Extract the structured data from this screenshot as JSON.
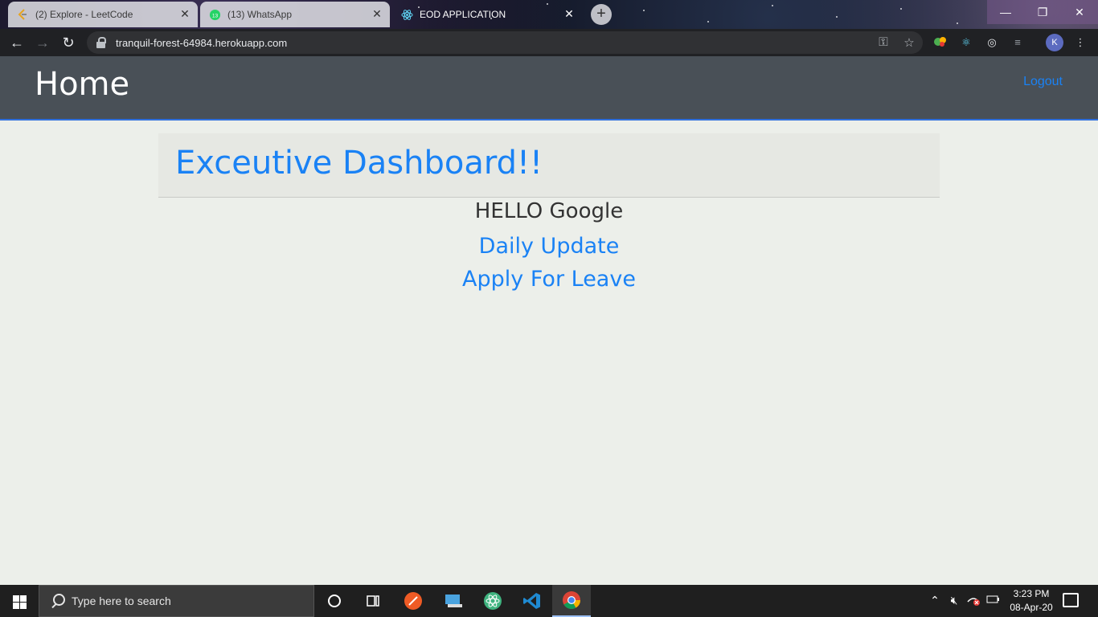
{
  "browser": {
    "tabs": [
      {
        "title": "(2) Explore - LeetCode",
        "icon": "leetcode-icon",
        "active": false
      },
      {
        "title": "(13) WhatsApp",
        "icon": "whatsapp-icon",
        "active": false
      },
      {
        "title": "EOD APPLICATION",
        "icon": "react-icon",
        "active": true
      }
    ],
    "url": "tranquil-forest-64984.herokuapp.com",
    "profile_initial": "K",
    "new_tab_glyph": "+"
  },
  "app": {
    "brand": "Home",
    "logout": "Logout",
    "heading": "Exceutive Dashboard!!",
    "greeting": "HELLO Google",
    "links": [
      "Daily Update",
      "Apply For Leave"
    ]
  },
  "taskbar": {
    "search_placeholder": "Type here to search",
    "time": "3:23 PM",
    "date": "08-Apr-20"
  },
  "colors": {
    "navbar": "#495057",
    "link": "#1a82f5",
    "page_bg": "#ecefea",
    "jumbotron": "#e6e8e3"
  }
}
